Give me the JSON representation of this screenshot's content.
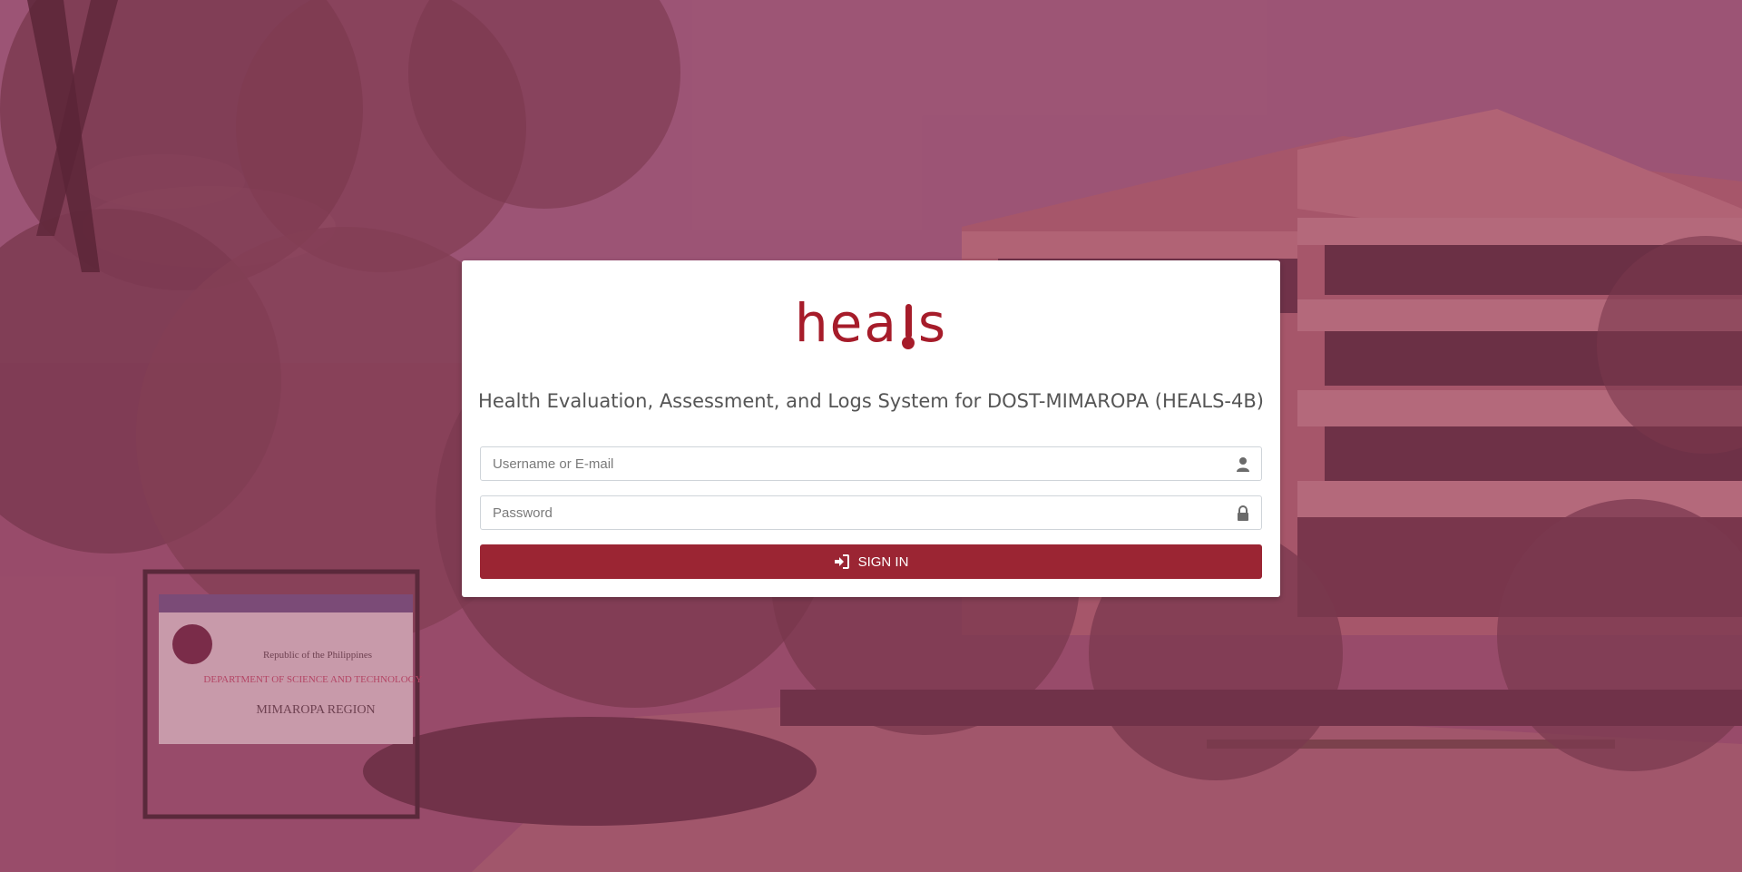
{
  "app": {
    "logo_text_left": "hea",
    "logo_text_right": "s",
    "subtitle": "Health Evaluation, Assessment, and Logs System for DOST-MIMAROPA (HEALS-4B)"
  },
  "background_sign": {
    "line1": "Republic of the Philippines",
    "line2": "DEPARTMENT OF SCIENCE AND TECHNOLOGY",
    "line3": "MIMAROPA REGION"
  },
  "form": {
    "username_placeholder": "Username or E-mail",
    "username_value": "",
    "username_icon": "user-icon",
    "password_placeholder": "Password",
    "password_value": "",
    "password_icon": "lock-icon",
    "signin_label": "SIGN IN",
    "signin_icon": "sign-in-icon"
  },
  "colors": {
    "brand": "#a61c2a",
    "button": "#9b2533",
    "overlay": "#963250"
  }
}
